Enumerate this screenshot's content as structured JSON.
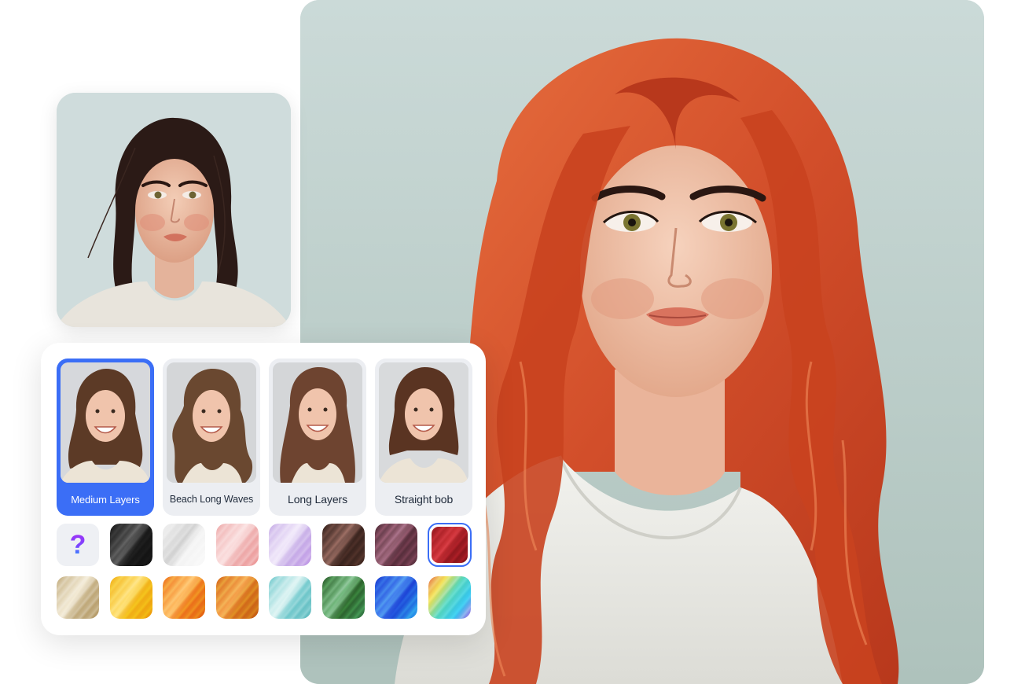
{
  "result_photo": {
    "subject": "woman-with-red-wavy-hair",
    "hair_color": "#d8532e",
    "background": "#c9d8d6"
  },
  "original_photo": {
    "subject": "woman-with-dark-updo-hair",
    "hair_color": "#2b1a16",
    "background": "#cfdcdc"
  },
  "hairstyles": {
    "selected_index": 0,
    "items": [
      {
        "label": "Medium Layers",
        "selected": true
      },
      {
        "label": "Beach Long Waves",
        "selected": false
      },
      {
        "label": "Long Layers",
        "selected": false
      },
      {
        "label": "Straight bob",
        "selected": false
      }
    ]
  },
  "hair_colors": {
    "accent": "#3b6ef6",
    "selected_index": 7,
    "unknown_icon": "?",
    "swatches": [
      {
        "name": "random",
        "colors": []
      },
      {
        "name": "black",
        "colors": [
          "#1a1a1a",
          "#5a5a5a",
          "#111111"
        ]
      },
      {
        "name": "silver-white",
        "colors": [
          "#f4f4f4",
          "#d4d4d4",
          "#fafafa"
        ]
      },
      {
        "name": "pink",
        "colors": [
          "#f0b3b3",
          "#fbe0e0",
          "#ee9f9f"
        ]
      },
      {
        "name": "lavender",
        "colors": [
          "#cdb6ea",
          "#f2eafb",
          "#c49ee8"
        ]
      },
      {
        "name": "dark-brown",
        "colors": [
          "#3e2620",
          "#8a6158",
          "#4a2e26"
        ]
      },
      {
        "name": "mauve",
        "colors": [
          "#5e3140",
          "#9a6478",
          "#6a3a4a"
        ]
      },
      {
        "name": "red",
        "colors": [
          "#9e1b22",
          "#d0343a",
          "#8a151b"
        ]
      },
      {
        "name": "blonde",
        "colors": [
          "#c8b48a",
          "#f4ecd8",
          "#b9a070"
        ]
      },
      {
        "name": "golden",
        "colors": [
          "#f3b81a",
          "#ffe27a",
          "#eea10a"
        ]
      },
      {
        "name": "orange",
        "colors": [
          "#ef7f1f",
          "#ffc16a",
          "#e56a12"
        ]
      },
      {
        "name": "copper",
        "colors": [
          "#d9781e",
          "#f6a851",
          "#c86414"
        ]
      },
      {
        "name": "aqua",
        "colors": [
          "#7fcfd2",
          "#dff5f4",
          "#6ac0c4"
        ]
      },
      {
        "name": "green",
        "colors": [
          "#2f6a2f",
          "#7fc08a",
          "#3d8a52"
        ]
      },
      {
        "name": "blue",
        "colors": [
          "#1d46d8",
          "#4a8cf0",
          "#2fb0f0"
        ]
      },
      {
        "name": "rainbow",
        "colors": [
          "#e8805a",
          "#f4e25a",
          "#5ad8c0",
          "#38c8f0",
          "#c078e8"
        ]
      }
    ]
  }
}
